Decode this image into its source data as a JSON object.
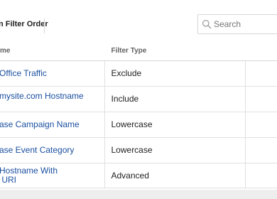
{
  "toolbar": {
    "filter_order_label": "n Filter Order",
    "search_placeholder": "Search"
  },
  "table": {
    "headers": [
      "me",
      "Filter Type",
      ""
    ],
    "rows": [
      {
        "name": "Office Traffic",
        "type": "Exclude"
      },
      {
        "name": "mysite.com Hostname",
        "type": "Include"
      },
      {
        "name": "ase Campaign Name",
        "type": "Lowercase"
      },
      {
        "name": "ase Event Category",
        "type": "Lowercase"
      },
      {
        "name": "Hostname With\n URI",
        "type": "Advanced"
      }
    ]
  },
  "colors": {
    "link": "#1a4fa0",
    "border": "#d6d6d6",
    "background": "#eeeeee"
  }
}
